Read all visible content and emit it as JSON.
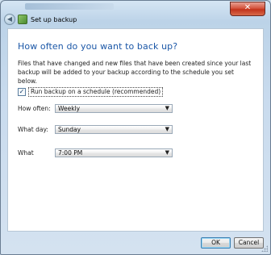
{
  "titlebar": {
    "close_glyph": "✕",
    "title": "Set up backup",
    "back_glyph": "◀"
  },
  "main": {
    "heading": "How often do you want to back up?",
    "description": "Files that have changed and new files that have been created since your last backup will be added to your backup according to the schedule you set below.",
    "schedule_checkbox": {
      "checked": true,
      "check_glyph": "✓",
      "label": "Run backup on a schedule (recommended)"
    },
    "fields": {
      "how_often": {
        "label": "How often:",
        "value": "Weekly"
      },
      "what_day": {
        "label": "What day:",
        "value": "Sunday"
      },
      "what_time": {
        "label": "What",
        "value": "7:00 PM"
      }
    },
    "chevron_glyph": "▼"
  },
  "footer": {
    "ok_label": "OK",
    "cancel_label": "Cancel"
  },
  "colors": {
    "heading": "#1b57a7",
    "close_button": "#c2331c",
    "frame": "#bcd3e8"
  }
}
